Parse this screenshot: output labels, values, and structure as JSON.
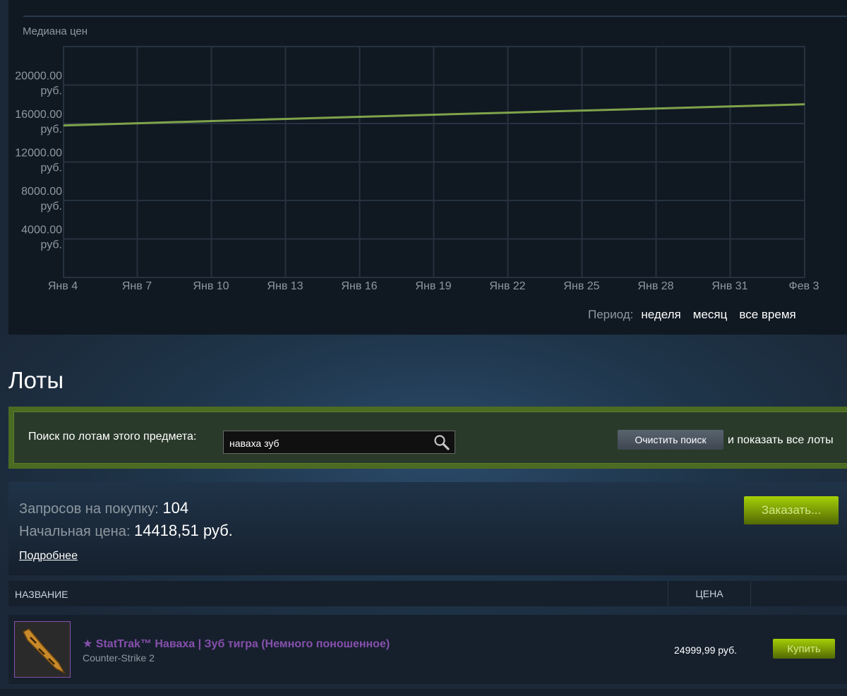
{
  "chart": {
    "label": "Медиана цен",
    "line_color": "#7fa34a"
  },
  "chart_data": {
    "type": "line",
    "title": "Медиана цен",
    "x": [
      "Янв 4",
      "Янв 7",
      "Янв 10",
      "Янв 13",
      "Янв 16",
      "Янв 19",
      "Янв 22",
      "Янв 25",
      "Янв 28",
      "Янв 31",
      "Фев 3"
    ],
    "series": [
      {
        "values": [
          15800,
          16030,
          16260,
          16480,
          16700,
          16920,
          17130,
          17350,
          17560,
          17780,
          18000
        ]
      }
    ],
    "y_ticks": [
      {
        "value": 20000,
        "line1": "20000.00",
        "line2": "руб."
      },
      {
        "value": 16000,
        "line1": "16000.00",
        "line2": "руб."
      },
      {
        "value": 12000,
        "line1": "12000.00",
        "line2": "руб."
      },
      {
        "value": 8000,
        "line1": "8000.00",
        "line2": "руб."
      },
      {
        "value": 4000,
        "line1": "4000.00",
        "line2": "руб."
      }
    ],
    "ylim": [
      0,
      24000
    ],
    "grid": true
  },
  "period": {
    "label": "Период:",
    "options": [
      "неделя",
      "месяц",
      "все время"
    ]
  },
  "lots": {
    "title": "Лоты"
  },
  "search": {
    "label": "Поиск по лотам этого предмета:",
    "value": "наваха зуб",
    "clear_label": "Очистить поиск",
    "show_all_label": "и показать все лоты"
  },
  "orders": {
    "requests_label": "Запросов на покупку:",
    "requests_value": "104",
    "start_price_label": "Начальная цена:",
    "start_price_value": "14418,51 руб.",
    "more_label": "Подробнее",
    "order_button": "Заказать..."
  },
  "table": {
    "col_name": "НАЗВАНИЕ",
    "col_price": "ЦЕНА"
  },
  "listing": {
    "name": "★ StatTrak™ Наваха | Зуб тигра (Немного поношенное)",
    "game": "Counter-Strike 2",
    "price": "24999,99 руб.",
    "buy_label": "Купить",
    "name_color": "#8650ac"
  }
}
